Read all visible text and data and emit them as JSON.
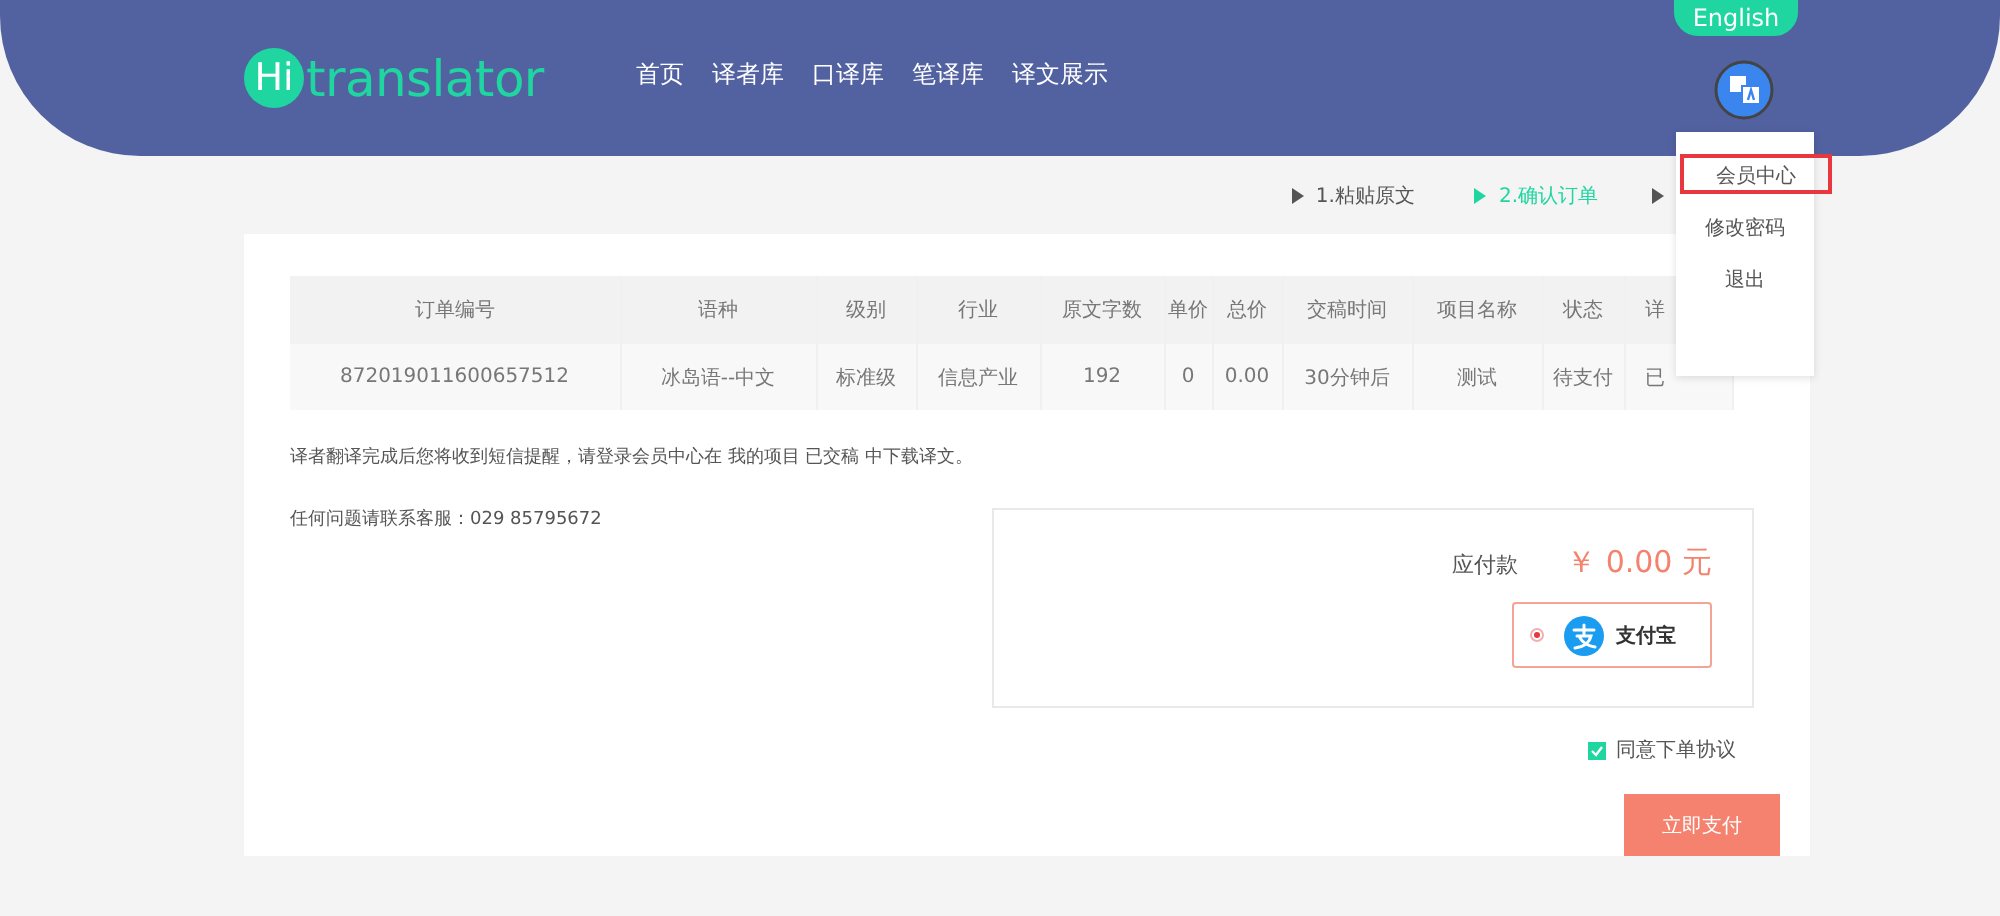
{
  "header": {
    "logo": {
      "mark": "Hi",
      "name": "translator"
    },
    "nav": [
      {
        "label": "首页"
      },
      {
        "label": "译者库"
      },
      {
        "label": "口译库"
      },
      {
        "label": "笔译库"
      },
      {
        "label": "译文展示"
      }
    ],
    "language_button": "English",
    "user_menu": {
      "items": [
        {
          "label": "会员中心",
          "selected": true
        },
        {
          "label": "修改密码",
          "selected": false
        },
        {
          "label": "退出",
          "selected": false
        }
      ]
    }
  },
  "steps": [
    {
      "label": "1.粘贴原文",
      "selected": false
    },
    {
      "label": "2.确认订单",
      "selected": true
    },
    {
      "selected": false
    }
  ],
  "table": {
    "columns": [
      "订单编号",
      "语种",
      "级别",
      "行业",
      "原文字数",
      "单价",
      "总价",
      "交稿时间",
      "项目名称",
      "状态",
      "详"
    ],
    "rows": [
      [
        "872019011600657512",
        "冰岛语--中文",
        "标准级",
        "信息产业",
        "192",
        "0",
        "0.00",
        "30分钟后",
        "测试",
        "待支付",
        "已"
      ]
    ]
  },
  "notice": "译者翻译完成后您将收到短信提醒，请登录会员中心在 我的项目 已交稿 中下载译文。",
  "contact": "任何问题请联系客服：029 85795672",
  "payment": {
    "amount_label": "应付款",
    "amount": "￥ 0.00 元",
    "methods": [
      {
        "label": "支付宝",
        "selected": true
      }
    ]
  },
  "agreement": {
    "label": "同意下单协议",
    "checked": true
  },
  "pay_button": "立即支付"
}
